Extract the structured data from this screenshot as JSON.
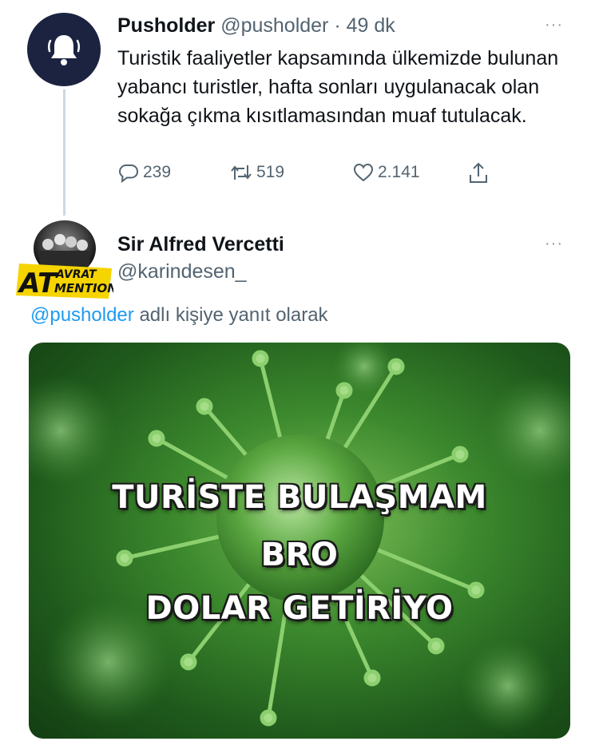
{
  "tweet_parent": {
    "name": "Pusholder",
    "handle": "@pusholder",
    "separator": " · ",
    "time": "49 dk",
    "text": "Turistik faaliyetler kapsamında ülkemizde bulunan yabancı turistler, hafta sonları uygulanacak olan sokağa çıkma kısıtlamasından muaf tutulacak.",
    "avatar_icon": "bell-icon",
    "more_label": "···",
    "replies": "239",
    "retweets": "519",
    "likes": "2.141"
  },
  "tweet_reply": {
    "name": "Sir Alfred Vercetti",
    "handle": "@karindesen_",
    "more_label": "···",
    "reply_handle": "@pusholder",
    "reply_suffix": " adlı kişiye yanıt olarak",
    "avatar_badge": {
      "big": "AT",
      "top": "AVRAT",
      "bottom": "MENTION"
    },
    "media_caption": [
      "TURİSTE BULAŞMAM",
      "BRO",
      "DOLAR GETİRİYO"
    ]
  },
  "colors": {
    "text": "#0f1419",
    "muted": "#536471",
    "link": "#1d9bf0",
    "avatar_bg": "#1b2340",
    "badge_yellow": "#f5d400"
  }
}
